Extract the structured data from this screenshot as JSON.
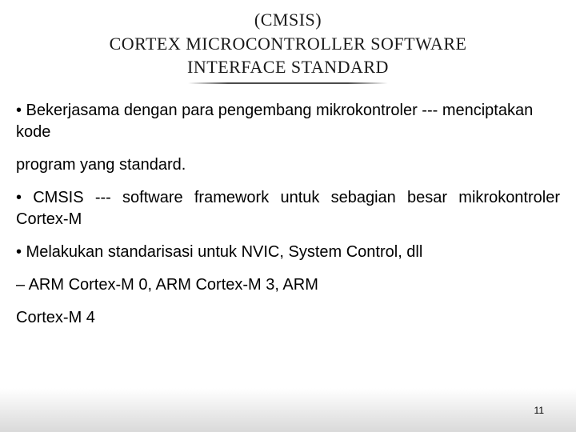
{
  "title": {
    "line1": "(CMSIS)",
    "line2": "CORTEX MICROCONTROLLER SOFTWARE",
    "line3": "INTERFACE STANDARD"
  },
  "bullets": {
    "b1": "• Bekerjasama dengan para pengembang mikrokontroler --- menciptakan kode",
    "b1b": "program yang standard.",
    "b2": "• CMSIS --- software framework untuk sebagian besar mikrokontroler Cortex-M",
    "b3": "• Melakukan standarisasi untuk NVIC, System Control, dll",
    "b4": "– ARM Cortex-M 0, ARM Cortex-M 3, ARM",
    "b4b": "Cortex-M 4"
  },
  "page_number": "11"
}
